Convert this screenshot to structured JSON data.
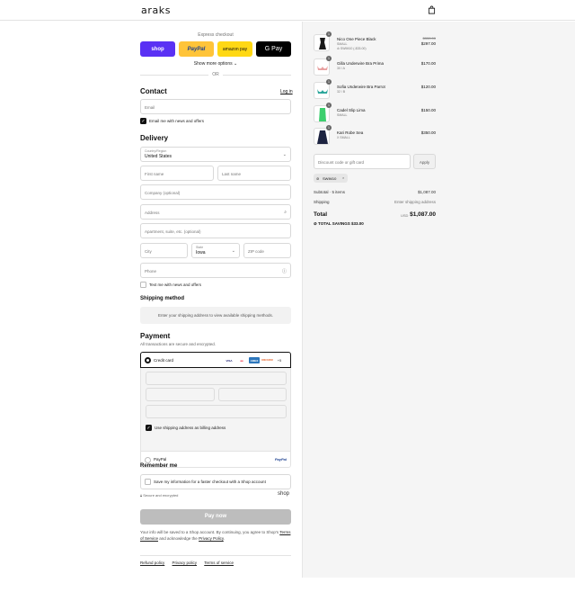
{
  "header": {
    "logo": "araks",
    "cart_icon": "shopping-bag-icon"
  },
  "express": {
    "label": "Express checkout",
    "shop": "shop",
    "paypal": "PayPal",
    "amazon": "amazon pay",
    "gpay": "G Pay",
    "more_options": "Show more options ⌄",
    "or": "OR"
  },
  "contact": {
    "title": "Contact",
    "login": "Log in",
    "email_placeholder": "Email",
    "newsletter_label": "Email me with news and offers",
    "newsletter_checked": true
  },
  "delivery": {
    "title": "Delivery",
    "country_label": "Country/Region",
    "country_value": "United States",
    "first_name": "First name",
    "last_name": "Last name",
    "company": "Company (optional)",
    "address": "Address",
    "apartment": "Apartment, suite, etc. (optional)",
    "city": "City",
    "state_label": "State",
    "state_value": "Iowa",
    "zip": "ZIP code",
    "phone": "Phone",
    "sms_label": "Text me with news and offers",
    "sms_checked": false
  },
  "shipping": {
    "title": "Shipping method",
    "note": "Enter your shipping address to view available shipping methods."
  },
  "payment": {
    "title": "Payment",
    "subtitle": "All transactions are secure and encrypted.",
    "credit_card_label": "Credit card",
    "brands": [
      "VISA",
      "MC",
      "AMEX",
      "DISCOVER",
      "+5"
    ],
    "billing_same_label": "Use shipping address as billing address",
    "billing_same_checked": true,
    "paypal_label": "PayPal",
    "paypal_logo": "PayPal"
  },
  "remember": {
    "title": "Remember me",
    "save_label": "Save my information for a faster checkout with a Shop account",
    "secure_label": "Secure and encrypted",
    "shop_logo": "shop"
  },
  "pay_now": "Pay now",
  "terms": {
    "text_before": "Your info will be saved to a Shop account. By continuing, you agree to Shop's",
    "tos": "Terms of Service",
    "middle": "and acknowledge the",
    "privacy": "Privacy Policy",
    "end": "."
  },
  "footer": {
    "refund": "Refund policy",
    "privacy": "Privacy policy",
    "tos": "Terms of service"
  },
  "order": {
    "items": [
      {
        "qty": "1",
        "name": "Nico One Piece Black",
        "variant": "SMALL",
        "discount": "SWIM10 (-$33.00)",
        "original": "$330.00",
        "price": "$297.00",
        "swatch": "#1a1a1a"
      },
      {
        "qty": "1",
        "name": "Gilla Underwire Bra Prima",
        "variant": "30 / A",
        "discount": "",
        "original": "",
        "price": "$170.00",
        "swatch": "#e8a0a0"
      },
      {
        "qty": "1",
        "name": "Sofia Underwire Bra Parrot",
        "variant": "32 / B",
        "discount": "",
        "original": "",
        "price": "$120.00",
        "swatch": "#2aa59a"
      },
      {
        "qty": "1",
        "name": "Cadel Slip Lima",
        "variant": "SMALL",
        "discount": "",
        "original": "",
        "price": "$150.00",
        "swatch": "#3ccf6e"
      },
      {
        "qty": "1",
        "name": "Kari Robe Sea",
        "variant": "X SMALL",
        "discount": "",
        "original": "",
        "price": "$350.00",
        "swatch": "#1c2340"
      }
    ],
    "discount_placeholder": "Discount code or gift card",
    "apply": "Apply",
    "applied_code": "SWIM10",
    "subtotal_label": "Subtotal · 5 items",
    "subtotal_value": "$1,087.00",
    "shipping_label": "Shipping",
    "shipping_value": "Enter shipping address",
    "total_label": "Total",
    "currency": "USD",
    "total_value": "$1,087.00",
    "savings": "TOTAL SAVINGS  $33.00"
  }
}
